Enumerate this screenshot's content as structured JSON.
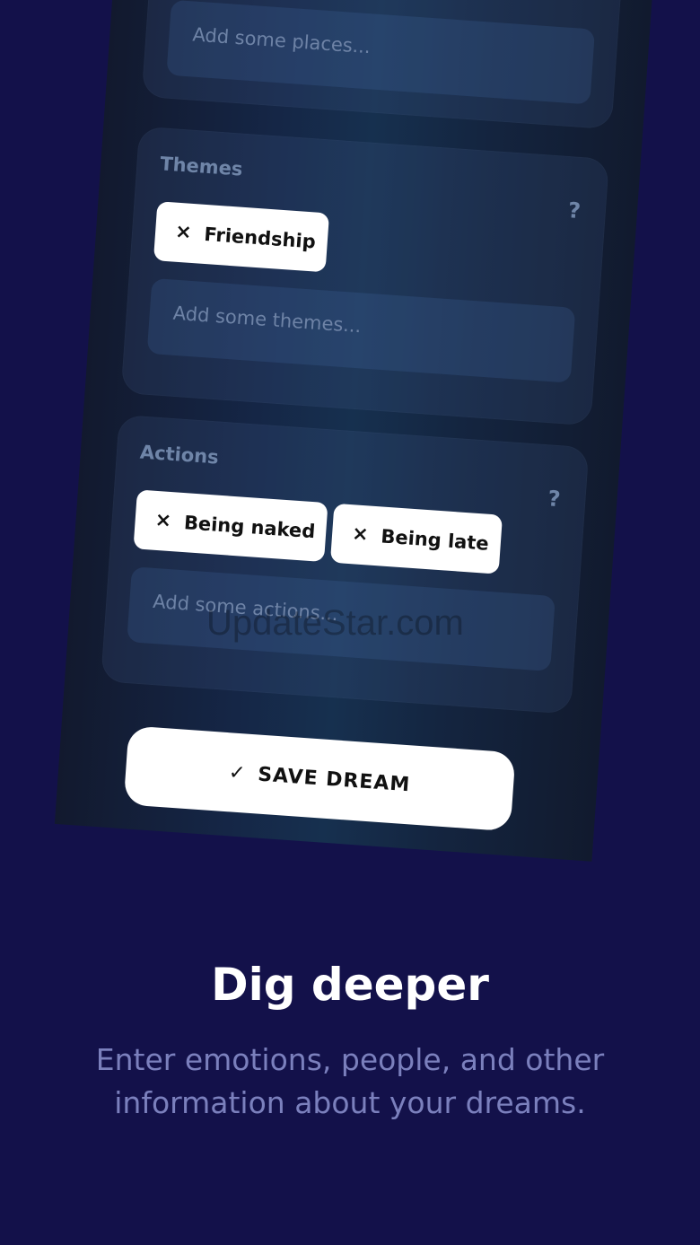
{
  "places": {
    "placeholder": "Add some places..."
  },
  "themes": {
    "title": "Themes",
    "help": "?",
    "chips": [
      {
        "close_icon": "×",
        "label": "Friendship"
      }
    ],
    "placeholder": "Add some themes..."
  },
  "actions": {
    "title": "Actions",
    "help": "?",
    "chips": [
      {
        "close_icon": "×",
        "label": "Being naked"
      },
      {
        "close_icon": "×",
        "label": "Being late"
      }
    ],
    "placeholder": "Add some actions..."
  },
  "save_button": {
    "icon": "✓",
    "label": "SAVE DREAM"
  },
  "watermark": "UpdateStar.com",
  "promo": {
    "title": "Dig deeper",
    "subtitle": "Enter emotions, people, and other information about your dreams."
  }
}
